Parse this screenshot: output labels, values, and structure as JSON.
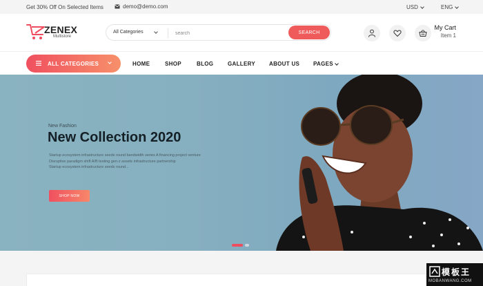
{
  "topbar": {
    "promo": "Get 30% Off On Selected Items",
    "email": "demo@demo.com",
    "currency": "USD",
    "language": "ENG"
  },
  "header": {
    "brand": "ZENEX",
    "brand_sub": "Multistore",
    "search": {
      "category": "All Categories",
      "placeholder": "search",
      "button": "SEARCH"
    },
    "cart": {
      "title": "My Cart",
      "items": "Item 1"
    }
  },
  "nav": {
    "all_categories": "ALL CATEGORIES",
    "links": [
      "HOME",
      "SHOP",
      "BLOG",
      "GALLERY",
      "ABOUT US",
      "PAGES"
    ]
  },
  "hero": {
    "eyebrow": "New Fashion",
    "headline": "New Collection 2020",
    "desc": [
      "Startup ecosystem infrastructure seeds round bandwidth series A financing project venture",
      "Disruptive paradigm shift A/B testing gen-z assets infrastructure partnership",
      "Startup ecosystem infrastructure seeds round..."
    ],
    "button": "SHOP NOW",
    "slide_active": 1,
    "slide_count": 2
  },
  "watermark": {
    "title": "模板王",
    "url": "MOBANWANG.COM"
  },
  "colors": {
    "accent": "#ef5a5a",
    "gradient_start": "#f0505f",
    "gradient_end": "#f7906a"
  },
  "icons": [
    "envelope-icon",
    "user-icon",
    "heart-icon",
    "basket-icon",
    "menu-icon",
    "chevron-down-icon"
  ]
}
